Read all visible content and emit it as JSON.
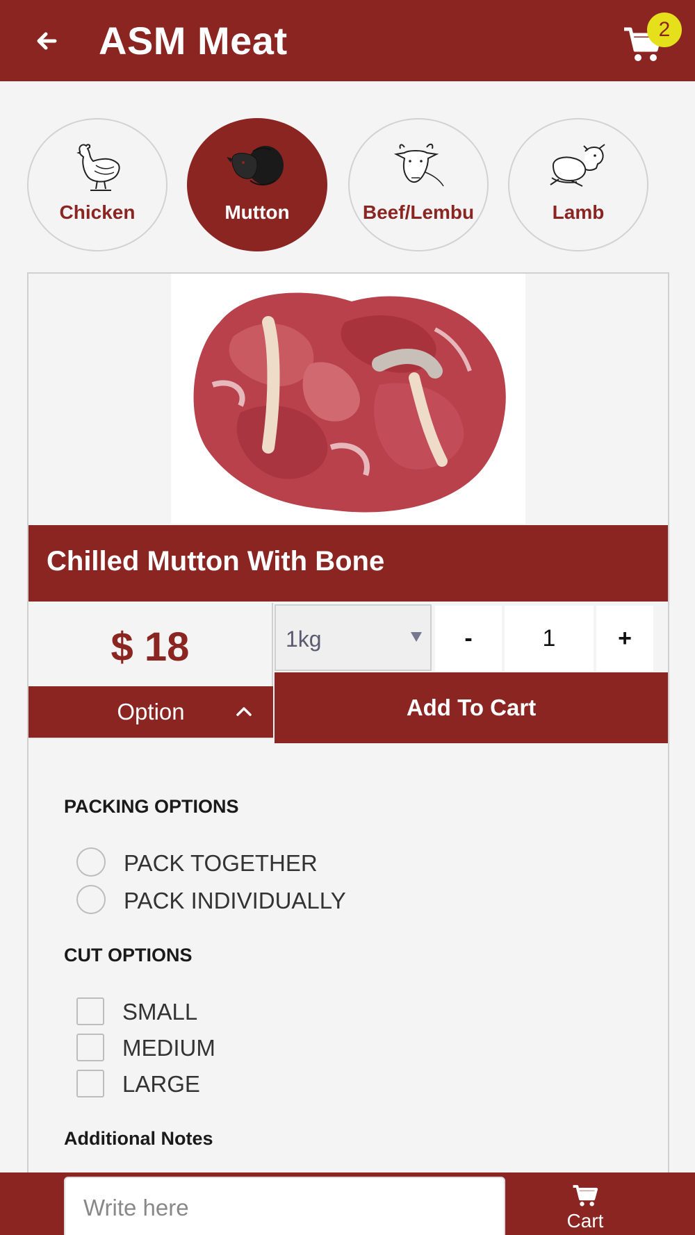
{
  "header": {
    "title": "ASM Meat",
    "cart_count": "2"
  },
  "categories": [
    {
      "label": "Chicken",
      "icon": "chicken-icon",
      "active": false
    },
    {
      "label": "Mutton",
      "icon": "sheep-icon",
      "active": true
    },
    {
      "label": "Beef/Lembu",
      "icon": "cow-icon",
      "active": false
    },
    {
      "label": "Lamb",
      "icon": "lamb-icon",
      "active": false
    }
  ],
  "product": {
    "title": "Chilled Mutton With Bone",
    "price": "$ 18",
    "weight": "1kg",
    "quantity": "1",
    "minus_label": "-",
    "plus_label": "+",
    "option_label": "Option",
    "add_to_cart_label": "Add To Cart"
  },
  "options": {
    "packing_heading": "PACKING OPTIONS",
    "packing": [
      "PACK TOGETHER",
      "PACK INDIVIDUALLY"
    ],
    "cut_heading": "CUT OPTIONS",
    "cut": [
      "SMALL",
      "MEDIUM",
      "LARGE"
    ],
    "notes_heading": "Additional Notes",
    "notes_placeholder": "Write here"
  },
  "bottom": {
    "cart_label": "Cart"
  },
  "colors": {
    "brand": "#8b2522",
    "badge": "#e6e01c",
    "background": "#f4f4f4"
  }
}
